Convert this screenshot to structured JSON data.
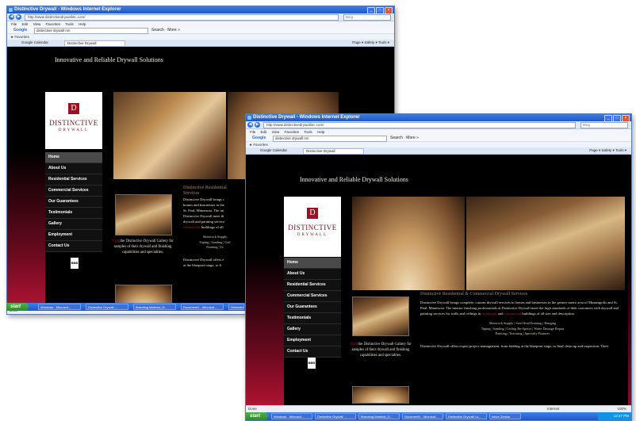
{
  "window1": {
    "title": "Distinctive Drywall - Windows Internet Explorer",
    "url": "http://www.distinctivedrywallinc.com/",
    "search_placeholder": "Bing",
    "menu": [
      "File",
      "Edit",
      "View",
      "Favorites",
      "Tools",
      "Help"
    ],
    "google_query": "distinctive drywall mn",
    "google_search_label": "Search",
    "google_more": "More »",
    "favorites_label": "Favorites",
    "tabs": [
      "Google Calendar",
      "Distinctive Drywall"
    ],
    "status": "Done",
    "tools_right": "Page ▾  Safety ▾  Tools ▾"
  },
  "window2": {
    "title": "Distinctive Drywall - Windows Internet Explorer",
    "url": "http://www.distinctivedrywallinc.com/",
    "search_placeholder": "Bing",
    "menu": [
      "File",
      "Edit",
      "View",
      "Favorites",
      "Tools",
      "Help"
    ],
    "google_query": "distinctive drywall mn",
    "google_search_label": "Search",
    "google_more": "More »",
    "favorites_label": "Favorites",
    "tabs": [
      "Google Calendar",
      "Distinctive Drywall"
    ],
    "status": "Done",
    "internet_label": "Internet",
    "zoom": "100%",
    "tools_right": "Page ▾  Safety ▾  Tools ▾"
  },
  "site": {
    "tagline": "Innovative and Reliable Drywall Solutions",
    "brand_monogram": "D",
    "brand_line1": "DISTINCTIVE",
    "brand_line2": "DRYWALL",
    "nav": [
      "Home",
      "About Us",
      "Residential Services",
      "Commercial Services",
      "Our Guarantees",
      "Testimonials",
      "Gallery",
      "Employment",
      "Contact Us"
    ],
    "heading": "Distinctive Residential & Commercial Drywall Services",
    "heading_w1": "Distinctive Residential",
    "heading_w1b": "Services",
    "para1_a": "Distinctive Drywall brings complete, custom drywall services to homes and businesses in the greater metro area of Minneapolis and St. Paul, Minnesota. The interior finishing professionals at Distinctive Drywall meet the high standards of their customers with drywall and painting services for walls and ceilings in",
    "link_residential": "residential",
    "and_word": "and",
    "link_commercial": "commercial",
    "para1_b": "buildings of all size and description.",
    "w1_para": [
      "Distinctive Drywall brings c",
      "homes and businesses in the",
      "St. Paul, Minnesota. The int",
      "Distinctive Drywall meet th",
      "drywall and painting service"
    ],
    "w1_para_tail": "buildings of all",
    "services_line1": "Sheetrock Supply  |  Steel Stud Framing  |  Hanging",
    "services_line2": "Taping  |  Sanding  |  Ceiling Re-Sprays  |  Water Damage Repair",
    "services_line3": "Painting  |  Texturing  |  Specialty Features",
    "w1_services": [
      "Sheetrock Supply",
      "Taping | Sanding | Ceil",
      "Painting | Te"
    ],
    "para2": "Distinctive Drywall offers expert project management, from bidding at the blueprint stage, to final clean up and inspection. Their",
    "w1_para2": [
      "Distinctive Drywall offers e",
      "at the blueprint stage, to fi"
    ],
    "gallery_visit": "Visit",
    "gallery_text": "the Distinctive Drywall Gallery for samples of their drywall and finishing capabilities and specialties.",
    "bbb": "BBB"
  },
  "taskbar": {
    "start": "start",
    "items": [
      "Windows - Microsof...",
      "Distinctive Drywall ...",
      "Branding Material_D...",
      "Document1 - Microsof...",
      "Distinctive Drywall Lo...",
      "Inbox Zeroke"
    ],
    "clock": "12:27 PM"
  }
}
